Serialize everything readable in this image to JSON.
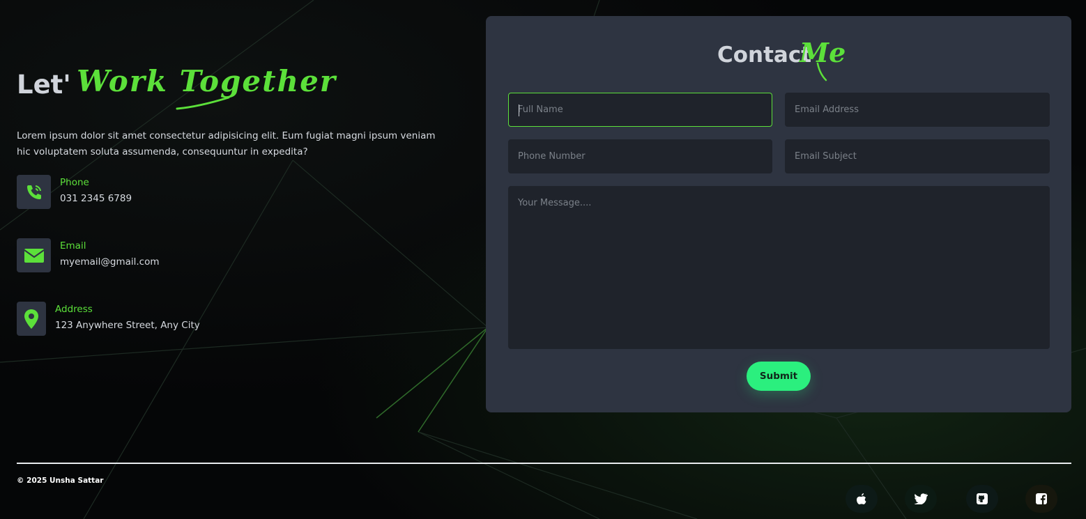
{
  "hero": {
    "title_plain": "Let'",
    "title_accent": "Work Together",
    "description": "Lorem ipsum dolor sit amet consectetur adipisicing elit. Eum fugiat magni ipsum veniam hic voluptatem soluta assumenda, consequuntur in expedita?"
  },
  "contact_info": [
    {
      "label": "Phone",
      "value": "031 2345 6789",
      "icon": "phone-icon"
    },
    {
      "label": "Email",
      "value": "myemail@gmail.com",
      "icon": "envelope-icon"
    },
    {
      "label": "Address",
      "value": "123 Anywhere Street, Any City",
      "icon": "location-pin-icon"
    }
  ],
  "form": {
    "title_plain": "Contact",
    "title_accent": "Me",
    "full_name_placeholder": "Full Name",
    "email_placeholder": "Email Address",
    "phone_placeholder": "Phone Number",
    "subject_placeholder": "Email Subject",
    "message_placeholder": "Your Message....",
    "full_name_value": "",
    "email_value": "",
    "phone_value": "",
    "subject_value": "",
    "message_value": "",
    "submit_label": "Submit"
  },
  "footer": {
    "copyright": "© 2025 Unsha Sattar",
    "social_icons": [
      "apple-icon",
      "twitter-icon",
      "github-icon",
      "facebook-icon"
    ]
  },
  "colors": {
    "accent": "#5ce03a",
    "card_bg": "#2e3441",
    "field_bg": "#1f232b",
    "submit_bg": "#2bef7e"
  }
}
